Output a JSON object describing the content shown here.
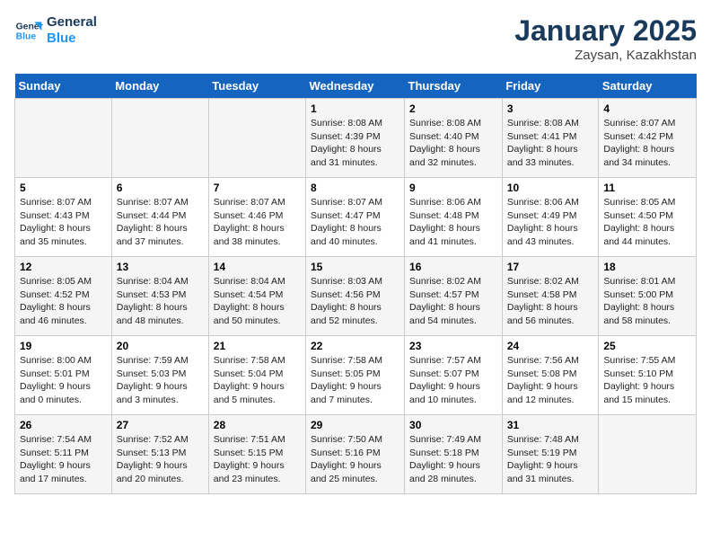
{
  "header": {
    "logo_line1": "General",
    "logo_line2": "Blue",
    "month": "January 2025",
    "location": "Zaysan, Kazakhstan"
  },
  "weekdays": [
    "Sunday",
    "Monday",
    "Tuesday",
    "Wednesday",
    "Thursday",
    "Friday",
    "Saturday"
  ],
  "weeks": [
    [
      {
        "day": "",
        "info": ""
      },
      {
        "day": "",
        "info": ""
      },
      {
        "day": "",
        "info": ""
      },
      {
        "day": "1",
        "info": "Sunrise: 8:08 AM\nSunset: 4:39 PM\nDaylight: 8 hours\nand 31 minutes."
      },
      {
        "day": "2",
        "info": "Sunrise: 8:08 AM\nSunset: 4:40 PM\nDaylight: 8 hours\nand 32 minutes."
      },
      {
        "day": "3",
        "info": "Sunrise: 8:08 AM\nSunset: 4:41 PM\nDaylight: 8 hours\nand 33 minutes."
      },
      {
        "day": "4",
        "info": "Sunrise: 8:07 AM\nSunset: 4:42 PM\nDaylight: 8 hours\nand 34 minutes."
      }
    ],
    [
      {
        "day": "5",
        "info": "Sunrise: 8:07 AM\nSunset: 4:43 PM\nDaylight: 8 hours\nand 35 minutes."
      },
      {
        "day": "6",
        "info": "Sunrise: 8:07 AM\nSunset: 4:44 PM\nDaylight: 8 hours\nand 37 minutes."
      },
      {
        "day": "7",
        "info": "Sunrise: 8:07 AM\nSunset: 4:46 PM\nDaylight: 8 hours\nand 38 minutes."
      },
      {
        "day": "8",
        "info": "Sunrise: 8:07 AM\nSunset: 4:47 PM\nDaylight: 8 hours\nand 40 minutes."
      },
      {
        "day": "9",
        "info": "Sunrise: 8:06 AM\nSunset: 4:48 PM\nDaylight: 8 hours\nand 41 minutes."
      },
      {
        "day": "10",
        "info": "Sunrise: 8:06 AM\nSunset: 4:49 PM\nDaylight: 8 hours\nand 43 minutes."
      },
      {
        "day": "11",
        "info": "Sunrise: 8:05 AM\nSunset: 4:50 PM\nDaylight: 8 hours\nand 44 minutes."
      }
    ],
    [
      {
        "day": "12",
        "info": "Sunrise: 8:05 AM\nSunset: 4:52 PM\nDaylight: 8 hours\nand 46 minutes."
      },
      {
        "day": "13",
        "info": "Sunrise: 8:04 AM\nSunset: 4:53 PM\nDaylight: 8 hours\nand 48 minutes."
      },
      {
        "day": "14",
        "info": "Sunrise: 8:04 AM\nSunset: 4:54 PM\nDaylight: 8 hours\nand 50 minutes."
      },
      {
        "day": "15",
        "info": "Sunrise: 8:03 AM\nSunset: 4:56 PM\nDaylight: 8 hours\nand 52 minutes."
      },
      {
        "day": "16",
        "info": "Sunrise: 8:02 AM\nSunset: 4:57 PM\nDaylight: 8 hours\nand 54 minutes."
      },
      {
        "day": "17",
        "info": "Sunrise: 8:02 AM\nSunset: 4:58 PM\nDaylight: 8 hours\nand 56 minutes."
      },
      {
        "day": "18",
        "info": "Sunrise: 8:01 AM\nSunset: 5:00 PM\nDaylight: 8 hours\nand 58 minutes."
      }
    ],
    [
      {
        "day": "19",
        "info": "Sunrise: 8:00 AM\nSunset: 5:01 PM\nDaylight: 9 hours\nand 0 minutes."
      },
      {
        "day": "20",
        "info": "Sunrise: 7:59 AM\nSunset: 5:03 PM\nDaylight: 9 hours\nand 3 minutes."
      },
      {
        "day": "21",
        "info": "Sunrise: 7:58 AM\nSunset: 5:04 PM\nDaylight: 9 hours\nand 5 minutes."
      },
      {
        "day": "22",
        "info": "Sunrise: 7:58 AM\nSunset: 5:05 PM\nDaylight: 9 hours\nand 7 minutes."
      },
      {
        "day": "23",
        "info": "Sunrise: 7:57 AM\nSunset: 5:07 PM\nDaylight: 9 hours\nand 10 minutes."
      },
      {
        "day": "24",
        "info": "Sunrise: 7:56 AM\nSunset: 5:08 PM\nDaylight: 9 hours\nand 12 minutes."
      },
      {
        "day": "25",
        "info": "Sunrise: 7:55 AM\nSunset: 5:10 PM\nDaylight: 9 hours\nand 15 minutes."
      }
    ],
    [
      {
        "day": "26",
        "info": "Sunrise: 7:54 AM\nSunset: 5:11 PM\nDaylight: 9 hours\nand 17 minutes."
      },
      {
        "day": "27",
        "info": "Sunrise: 7:52 AM\nSunset: 5:13 PM\nDaylight: 9 hours\nand 20 minutes."
      },
      {
        "day": "28",
        "info": "Sunrise: 7:51 AM\nSunset: 5:15 PM\nDaylight: 9 hours\nand 23 minutes."
      },
      {
        "day": "29",
        "info": "Sunrise: 7:50 AM\nSunset: 5:16 PM\nDaylight: 9 hours\nand 25 minutes."
      },
      {
        "day": "30",
        "info": "Sunrise: 7:49 AM\nSunset: 5:18 PM\nDaylight: 9 hours\nand 28 minutes."
      },
      {
        "day": "31",
        "info": "Sunrise: 7:48 AM\nSunset: 5:19 PM\nDaylight: 9 hours\nand 31 minutes."
      },
      {
        "day": "",
        "info": ""
      }
    ]
  ]
}
